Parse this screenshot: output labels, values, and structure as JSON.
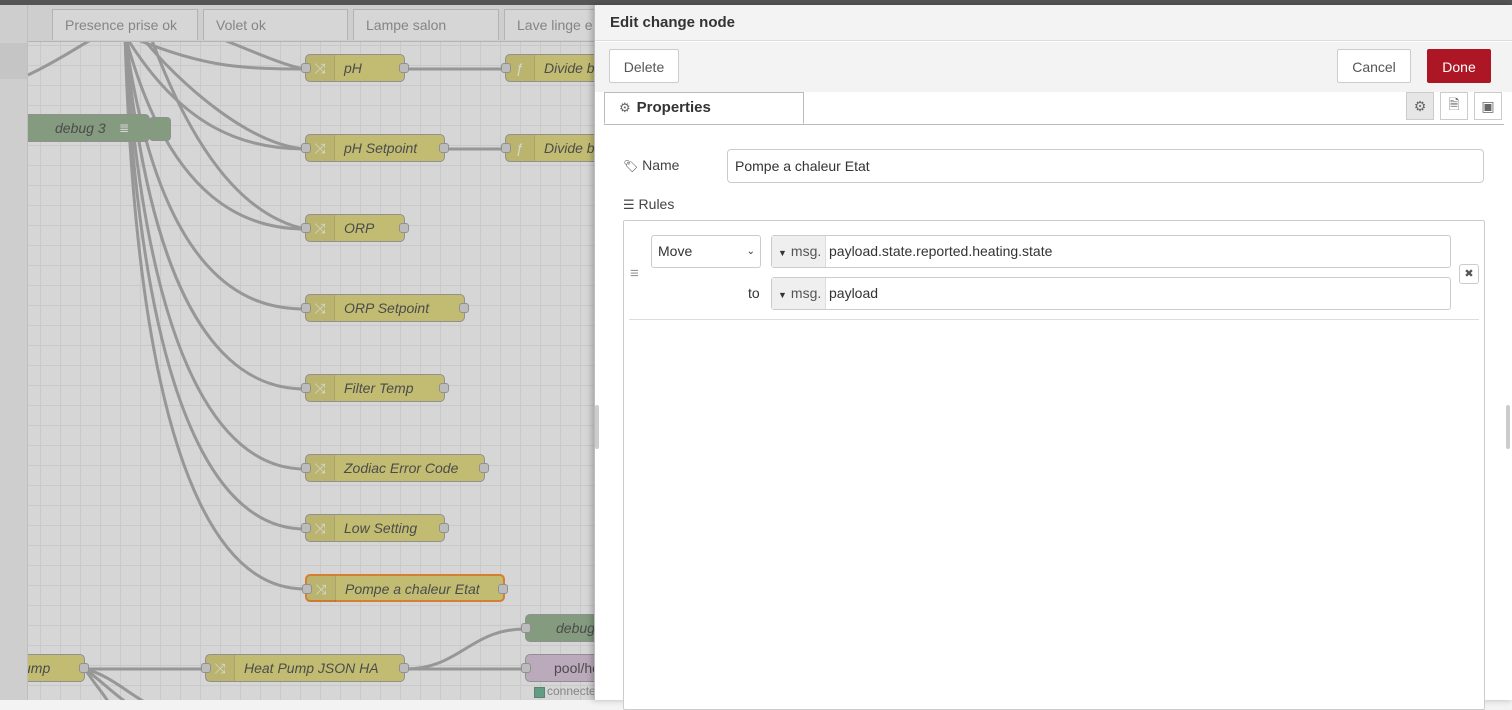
{
  "workspace": {
    "tabs": [
      "Presence prise ok",
      "Volet ok",
      "Lampe salon",
      "Lave linge e"
    ],
    "nodes": {
      "debug3": "debug 3",
      "ph": "pH",
      "ph_setpoint": "pH Setpoint",
      "orp": "ORP",
      "orp_setpoint": "ORP Setpoint",
      "filter_temp": "Filter Temp",
      "zodiac_error": "Zodiac Error Code",
      "low_setting": "Low Setting",
      "pompe": "Pompe a chaleur Etat",
      "divide1": "Divide b",
      "divide2": "Divide b",
      "heat_pump_json": "Heat Pump JSON HA",
      "left_partial": "ump",
      "debug_partial": "debug",
      "mqtt_partial": "pool/he",
      "status_connected": "connecte"
    }
  },
  "tray": {
    "title": "Edit change node",
    "delete_label": "Delete",
    "cancel_label": "Cancel",
    "done_label": "Done",
    "tab_properties": "Properties",
    "name_label": "Name",
    "name_value": "Pompe a chaleur Etat",
    "rules_label": "Rules",
    "rule": {
      "action": "Move",
      "source_type": "msg.",
      "source_value": "payload.state.reported.heating.state",
      "to_label": "to",
      "target_type": "msg.",
      "target_value": "payload"
    }
  },
  "colors": {
    "change_node": "#e2d96e",
    "debug_node": "#87a980",
    "primary_button": "#ad1625",
    "selection": "#ff7f0e"
  }
}
